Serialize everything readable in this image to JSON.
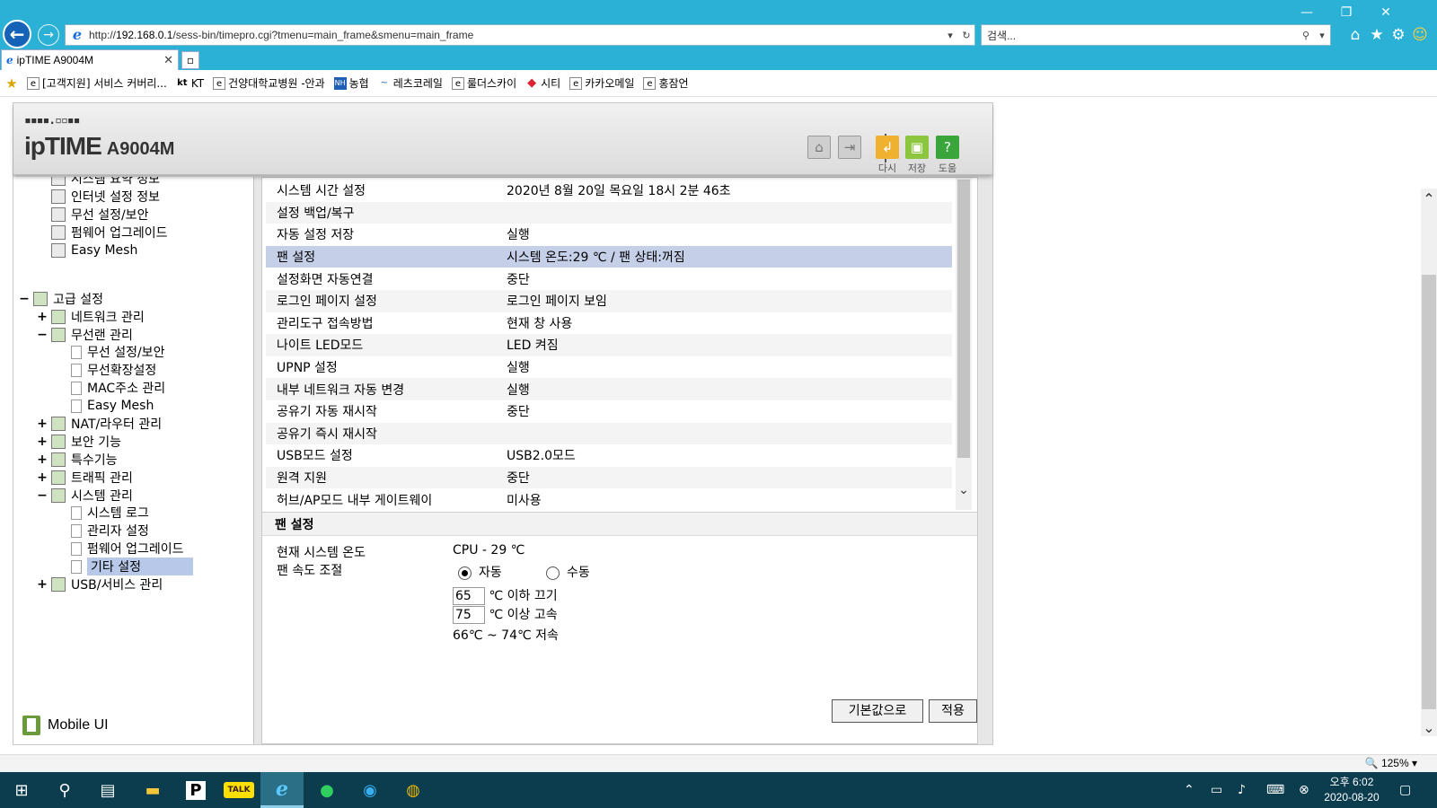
{
  "browser": {
    "url_prefix": "http://",
    "url_host": "192.168.0.1",
    "url_path": "/sess-bin/timepro.cgi?tmenu=main_frame&smenu=main_frame",
    "search_placeholder": "검색...",
    "tab_title": "ipTIME A9004M",
    "favorites": [
      "[고객지원] 서비스 커버리...",
      "KT",
      "건양대학교병원 -안과",
      "농협",
      "레츠코레일",
      "룰더스카이",
      "시티",
      "카카오메일",
      "홍잠언"
    ],
    "zoom": "125%"
  },
  "router": {
    "logo_dots": "▪▪▪▪.▫▫▪▪",
    "brand": "ipTIME",
    "model": "A9004M",
    "header_buttons": [
      {
        "label": "다시"
      },
      {
        "label": "저장"
      },
      {
        "label": "도움"
      }
    ],
    "tree": [
      {
        "label": "시스템 요약 정보"
      },
      {
        "label": "인터넷 설정 정보"
      },
      {
        "label": "무선 설정/보안"
      },
      {
        "label": "펌웨어 업그레이드"
      },
      {
        "label": "Easy Mesh"
      },
      {
        "label": "고급 설정"
      },
      {
        "label": "네트워크 관리"
      },
      {
        "label": "무선랜 관리"
      },
      {
        "label": "무선 설정/보안"
      },
      {
        "label": "무선확장설정"
      },
      {
        "label": "MAC주소 관리"
      },
      {
        "label": "Easy Mesh"
      },
      {
        "label": "NAT/라우터 관리"
      },
      {
        "label": "보안 기능"
      },
      {
        "label": "특수기능"
      },
      {
        "label": "트래픽 관리"
      },
      {
        "label": "시스템 관리"
      },
      {
        "label": "시스템 로그"
      },
      {
        "label": "관리자 설정"
      },
      {
        "label": "펌웨어 업그레이드"
      },
      {
        "label": "기타 설정"
      },
      {
        "label": "USB/서비스 관리"
      }
    ],
    "mobile_ui": "Mobile UI",
    "settings": [
      {
        "k": "시스템 시간 설정",
        "v": "2020년 8월 20일 목요일 18시 2분 46초"
      },
      {
        "k": "설정 백업/복구",
        "v": ""
      },
      {
        "k": "자동 설정 저장",
        "v": "실행"
      },
      {
        "k": "팬 설정",
        "v": "시스템 온도:29 ℃ / 팬 상태:꺼짐"
      },
      {
        "k": "설정화면 자동연결",
        "v": "중단"
      },
      {
        "k": "로그인 페이지 설정",
        "v": "로그인 페이지 보임"
      },
      {
        "k": "관리도구 접속방법",
        "v": "현재 창 사용"
      },
      {
        "k": "나이트 LED모드",
        "v": "LED 켜짐"
      },
      {
        "k": "UPNP 설정",
        "v": "실행"
      },
      {
        "k": "내부 네트워크 자동 변경",
        "v": "실행"
      },
      {
        "k": "공유기 자동 재시작",
        "v": "중단"
      },
      {
        "k": "공유기 즉시 재시작",
        "v": ""
      },
      {
        "k": "USB모드 설정",
        "v": "USB2.0모드"
      },
      {
        "k": "원격 지원",
        "v": "중단"
      },
      {
        "k": "허브/AP모드 내부 게이트웨이",
        "v": "미사용"
      }
    ],
    "fan": {
      "title": "팬 설정",
      "temp_label": "현재 시스템 온도",
      "temp_value": "CPU - 29 ℃",
      "speed_label": "팬 속도 조절",
      "mode_auto": "자동",
      "mode_manual": "수동",
      "low_value": "65",
      "low_text": "℃ 이하 끄기",
      "high_value": "75",
      "high_text": "℃ 이상 고속",
      "mid_text": "66℃ ~ 74℃ 저속"
    },
    "btn_default": "기본값으로",
    "btn_apply": "적용"
  },
  "taskbar": {
    "clock_time": "오후 6:02",
    "clock_date": "2020-08-20"
  }
}
